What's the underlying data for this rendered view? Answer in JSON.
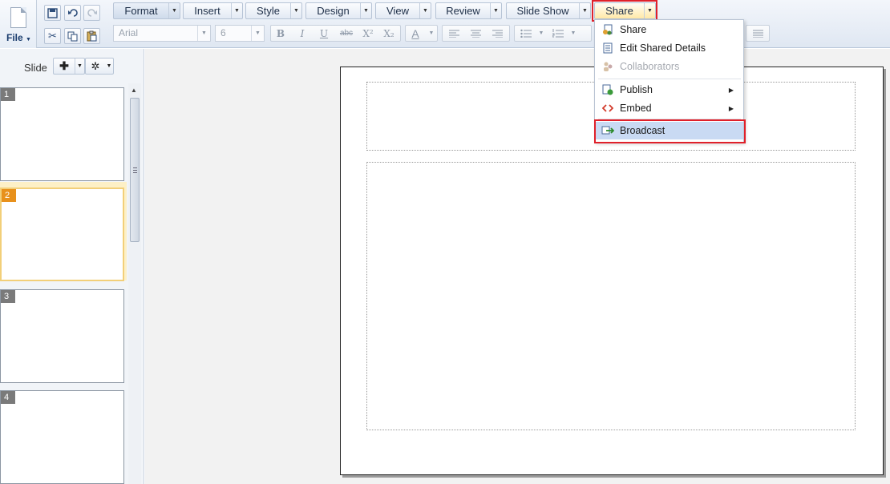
{
  "file_menu": {
    "label": "File"
  },
  "menus": [
    "Format",
    "Insert",
    "Style",
    "Design",
    "View",
    "Review",
    "Slide Show",
    "Share"
  ],
  "format_bar": {
    "font_name": "Arial",
    "font_size": "6"
  },
  "slide_panel": {
    "title": "Slide"
  },
  "slides": [
    {
      "number": "1"
    },
    {
      "number": "2",
      "selected": true
    },
    {
      "number": "3"
    },
    {
      "number": "4"
    }
  ],
  "share_menu": {
    "items": [
      {
        "label": "Share",
        "icon": "share-icon",
        "enabled": true
      },
      {
        "label": "Edit Shared Details",
        "icon": "document-icon",
        "enabled": true
      },
      {
        "label": "Collaborators",
        "icon": "users-icon",
        "enabled": false
      },
      {
        "label": "Publish",
        "icon": "publish-icon",
        "enabled": true,
        "submenu": true
      },
      {
        "label": "Embed",
        "icon": "embed-icon",
        "enabled": true,
        "submenu": true
      },
      {
        "label": "Broadcast",
        "icon": "broadcast-icon",
        "enabled": true,
        "hovered": true
      }
    ]
  },
  "colors": {
    "highlight": "#e0202a",
    "selected_slide": "#e8911c",
    "menu_hover": "#c9daf3"
  }
}
